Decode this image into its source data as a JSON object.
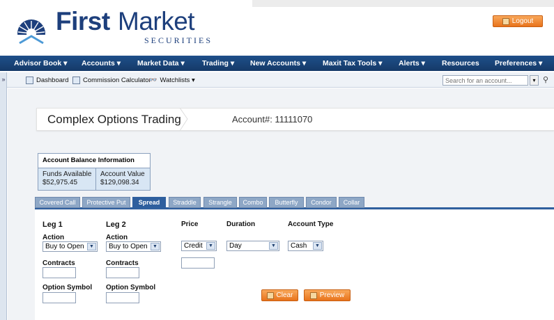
{
  "header": {
    "logo_first": "First",
    "logo_market": "Market",
    "logo_sub": "SECURITIES",
    "logout_label": "Logout"
  },
  "nav": {
    "items": [
      {
        "label": "Advisor Book ▾"
      },
      {
        "label": "Accounts ▾"
      },
      {
        "label": "Market Data ▾"
      },
      {
        "label": "Trading ▾"
      },
      {
        "label": "New Accounts ▾"
      },
      {
        "label": "Maxit Tax Tools ▾"
      },
      {
        "label": "Alerts ▾"
      },
      {
        "label": "Resources"
      },
      {
        "label": "Preferences ▾"
      }
    ]
  },
  "toolbar": {
    "toggle": "»",
    "dashboard": "Dashboard",
    "commission": "Commission Calculator",
    "watchlists": "Watchlists ▾",
    "search_placeholder": "Search for an account..."
  },
  "page": {
    "title": "Complex Options Trading",
    "account_label": "Account#: 11111070"
  },
  "balance": {
    "heading": "Account Balance Information",
    "funds_label": "Funds Available",
    "funds_value": "$52,975.45",
    "value_label": "Account Value",
    "value_value": "$129,098.34"
  },
  "tabs": [
    {
      "label": "Covered Call",
      "active": false
    },
    {
      "label": "Protective Put",
      "active": false
    },
    {
      "label": "Spread",
      "active": true
    },
    {
      "label": "Straddle",
      "active": false
    },
    {
      "label": "Strangle",
      "active": false
    },
    {
      "label": "Combo",
      "active": false
    },
    {
      "label": "Butterfly",
      "active": false
    },
    {
      "label": "Condor",
      "active": false
    },
    {
      "label": "Collar",
      "active": false
    }
  ],
  "form": {
    "leg1": {
      "heading": "Leg 1",
      "action_label": "Action",
      "action_value": "Buy to Open",
      "contracts_label": "Contracts",
      "symbol_label": "Option Symbol"
    },
    "leg2": {
      "heading": "Leg 2",
      "action_label": "Action",
      "action_value": "Buy to Open",
      "contracts_label": "Contracts",
      "symbol_label": "Option Symbol"
    },
    "price": {
      "label": "Price",
      "value": "Credit"
    },
    "duration": {
      "label": "Duration",
      "value": "Day"
    },
    "account_type": {
      "label": "Account Type",
      "value": "Cash"
    },
    "clear_label": "Clear",
    "preview_label": "Preview"
  },
  "colors": {
    "brand_blue": "#1d3f7c",
    "nav_bg": "#1e4f8a",
    "tab_active": "#2f5f9e",
    "button_orange": "#e8731c"
  }
}
